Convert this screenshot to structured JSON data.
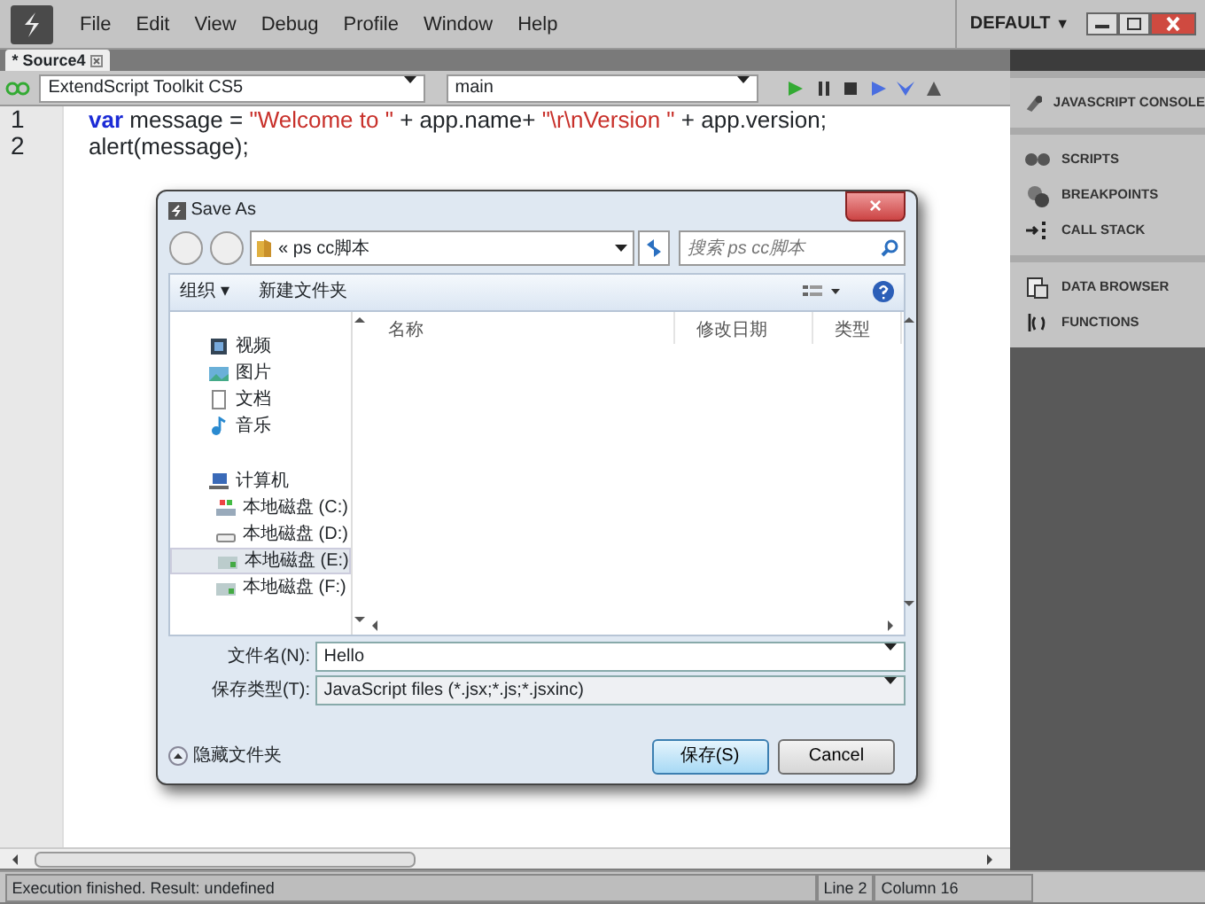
{
  "menu": [
    "File",
    "Edit",
    "View",
    "Debug",
    "Profile",
    "Window",
    "Help"
  ],
  "workspace": {
    "label": "DEFAULT",
    "caret": "▼"
  },
  "tabs": [
    {
      "label": "* Source4",
      "selected": true
    }
  ],
  "target_select": {
    "value": "ExtendScript Toolkit CS5"
  },
  "engine_select": {
    "value": "main"
  },
  "debug_buttons": [
    {
      "kind": "run",
      "disabled": false
    },
    {
      "kind": "pause",
      "disabled": false
    },
    {
      "kind": "stop",
      "disabled": false
    },
    {
      "kind": "step-over",
      "disabled": false
    },
    {
      "kind": "step-into",
      "disabled": false
    },
    {
      "kind": "step-out",
      "disabled": false
    }
  ],
  "code": [
    {
      "number": "1",
      "tokens": [
        {
          "kind": "keyword",
          "text": "var"
        },
        {
          "kind": "plain",
          "text": " message = "
        },
        {
          "kind": "string",
          "text": "\"Welcome to \""
        },
        {
          "kind": "plain",
          "text": " + app.name+ "
        },
        {
          "kind": "string",
          "text": "\"\\r\\nVersion \""
        },
        {
          "kind": "plain",
          "text": " + app.version;"
        }
      ]
    },
    {
      "number": "2",
      "tokens": [
        {
          "kind": "plain",
          "text": "alert(message);"
        }
      ]
    }
  ],
  "panels": [
    [
      {
        "kind": "console",
        "label": "JAVASCRIPT CONSOLE"
      }
    ],
    [
      {
        "kind": "scripts",
        "label": "SCRIPTS"
      },
      {
        "kind": "breakpoints",
        "label": "BREAKPOINTS"
      },
      {
        "kind": "callstack",
        "label": "CALL STACK"
      }
    ],
    [
      {
        "kind": "data",
        "label": "DATA BROWSER"
      },
      {
        "kind": "functions",
        "label": "FUNCTIONS"
      }
    ]
  ],
  "dialog": {
    "title": "Save As",
    "close": "×",
    "path": {
      "prefix": "«",
      "folder": "ps cc脚本"
    },
    "search": {
      "placeholder": "搜索 ps cc脚本"
    },
    "toolbar": {
      "organize": "组织 ▾",
      "new_folder": "新建文件夹"
    },
    "nav": [
      {
        "kind": "video",
        "label": "视频",
        "selected": false
      },
      {
        "kind": "pictures",
        "label": "图片",
        "selected": false
      },
      {
        "kind": "documents",
        "label": "文档",
        "selected": false
      },
      {
        "kind": "music",
        "label": "音乐",
        "selected": false
      },
      {
        "kind": "computer",
        "label": "计算机",
        "selected": false,
        "children": [
          {
            "kind": "system-drive",
            "label": "本地磁盘 (C:)",
            "selected": false
          },
          {
            "kind": "drive",
            "label": "本地磁盘 (D:)",
            "selected": false
          },
          {
            "kind": "disk",
            "label": "本地磁盘 (E:)",
            "selected": true
          },
          {
            "kind": "disk",
            "label": "本地磁盘 (F:)",
            "selected": false
          }
        ]
      }
    ],
    "columns": [
      "名称",
      "修改日期",
      "类型"
    ],
    "filename_label": "文件名(N):",
    "filename": "Hello",
    "type_label": "保存类型(T):",
    "type": "JavaScript files (*.jsx;*.js;*.jsxinc)",
    "hide_folders": "隐藏文件夹",
    "buttons": [
      {
        "label": "保存(S)",
        "default": true
      },
      {
        "label": "Cancel",
        "default": false
      }
    ]
  },
  "status_bar": {
    "message": "Execution finished. Result: undefined",
    "line": "Line 2",
    "column": "Column 16"
  }
}
